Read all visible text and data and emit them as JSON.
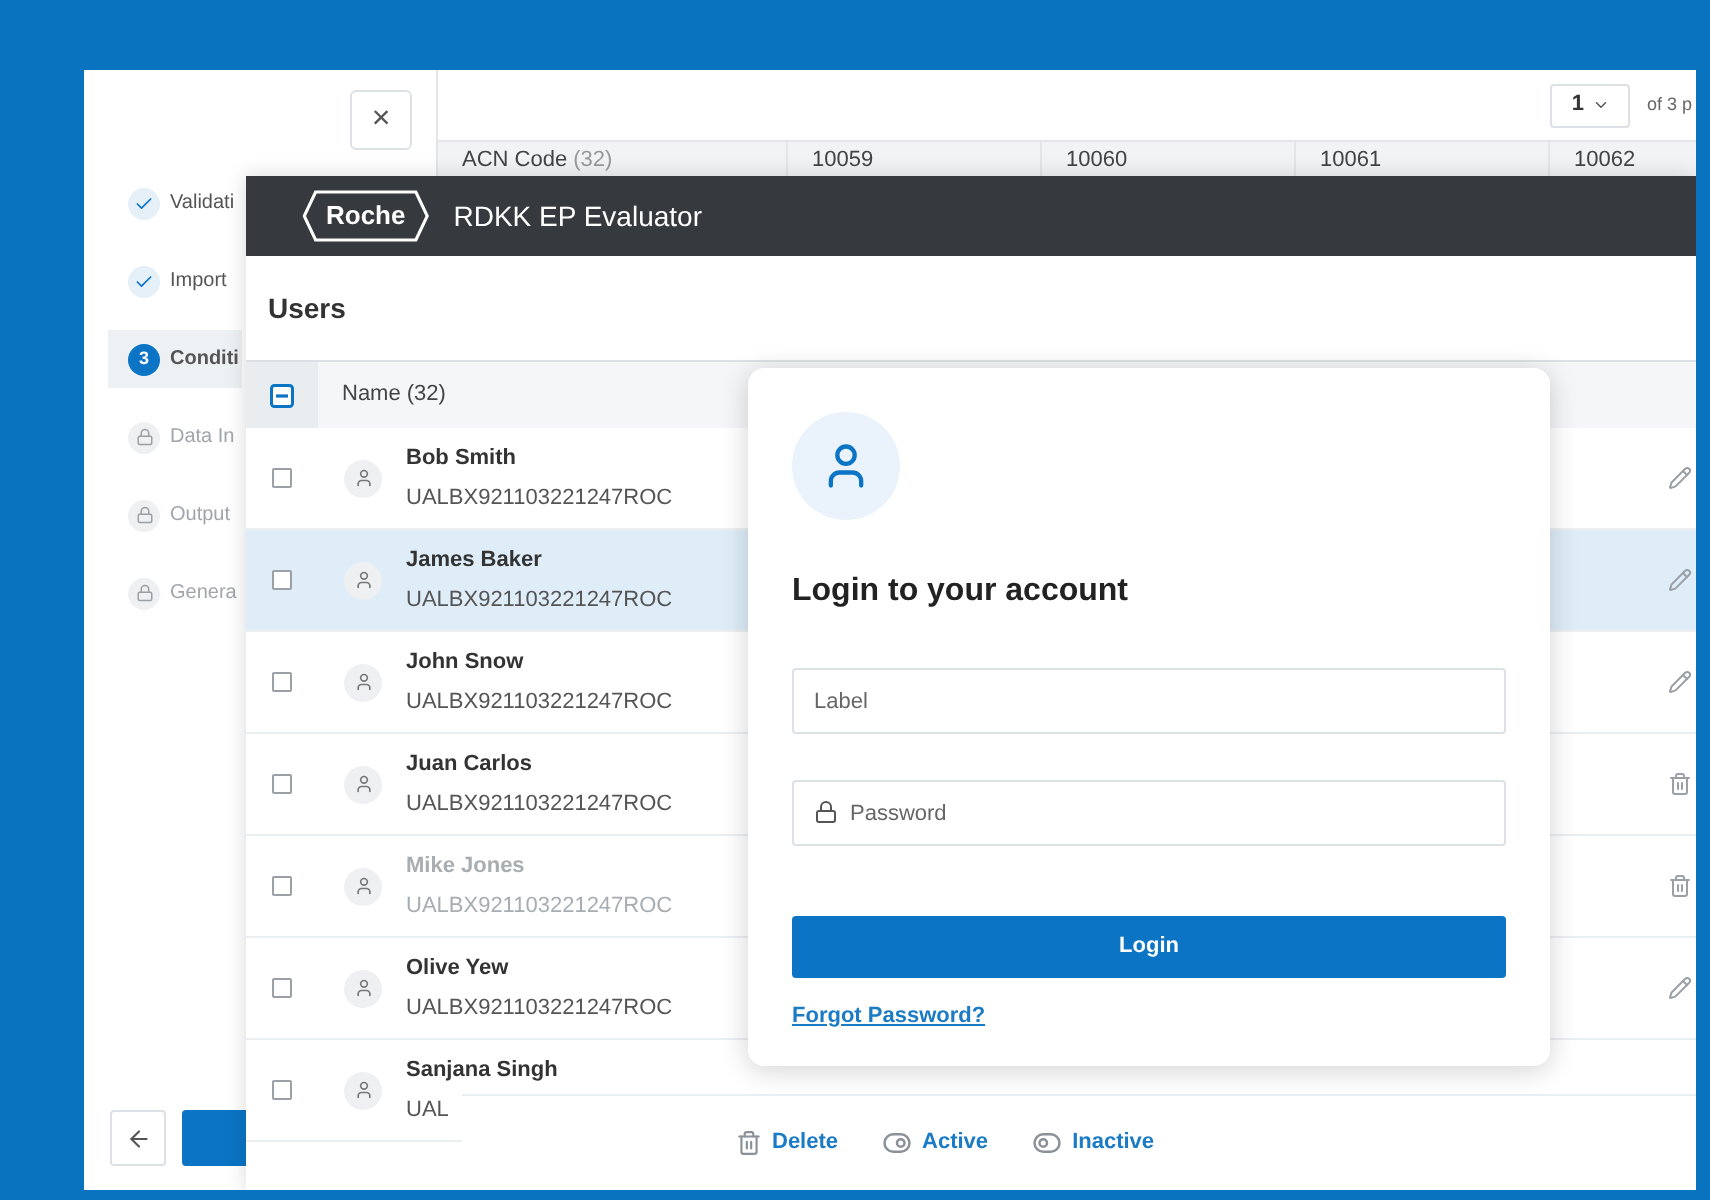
{
  "back_panel": {
    "close": "×",
    "steps": [
      {
        "label": "Validati",
        "kind": "done",
        "selected": false
      },
      {
        "label": "Import",
        "kind": "done",
        "selected": false
      },
      {
        "label": "Conditi",
        "kind": "current",
        "number": "3",
        "selected": true
      },
      {
        "label": "Data In",
        "kind": "locked",
        "selected": false
      },
      {
        "label": "Output",
        "kind": "locked",
        "selected": false
      },
      {
        "label": "Genera",
        "kind": "locked",
        "selected": false
      }
    ],
    "pagination": {
      "page": "1",
      "of": "of 3 p"
    },
    "table": {
      "columns": [
        {
          "label": "ACN Code",
          "count": "(32)"
        },
        {
          "label": "10059"
        },
        {
          "label": "10060"
        },
        {
          "label": "10061"
        },
        {
          "label": "10062"
        }
      ]
    }
  },
  "window": {
    "logo": "Roche",
    "title": "RDKK EP Evaluator"
  },
  "users": {
    "title": "Users",
    "column": "Name (32)",
    "header_checkbox_indeterminate": true,
    "rows": [
      {
        "name": "Bob Smith",
        "id": "UALBX921103221247ROC",
        "selected": false,
        "disabled": false,
        "kind": "edit"
      },
      {
        "name": "James Baker",
        "id": "UALBX921103221247ROC",
        "selected": true,
        "disabled": false,
        "kind": "edit"
      },
      {
        "name": "John Snow",
        "id": "UALBX921103221247ROC",
        "selected": false,
        "disabled": false,
        "kind": "edit"
      },
      {
        "name": "Juan Carlos",
        "id": "UALBX921103221247ROC",
        "selected": false,
        "disabled": false,
        "kind": "delete"
      },
      {
        "name": "Mike Jones",
        "id": "UALBX921103221247ROC",
        "selected": false,
        "disabled": true,
        "kind": "delete"
      },
      {
        "name": "Olive Yew",
        "id": "UALBX921103221247ROC",
        "selected": false,
        "disabled": false,
        "kind": "edit"
      },
      {
        "name": "Sanjana Singh",
        "id": "UAL",
        "selected": false,
        "disabled": false
      }
    ]
  },
  "action_bar": [
    {
      "label": "Delete",
      "kind": "delete"
    },
    {
      "label": "Active",
      "kind": "active"
    },
    {
      "label": "Inactive",
      "kind": "inactive"
    }
  ],
  "login": {
    "title": "Login to your account",
    "label_placeholder": "Label",
    "password_placeholder": "Password",
    "button": "Login",
    "forgot": "Forgot Password?"
  }
}
